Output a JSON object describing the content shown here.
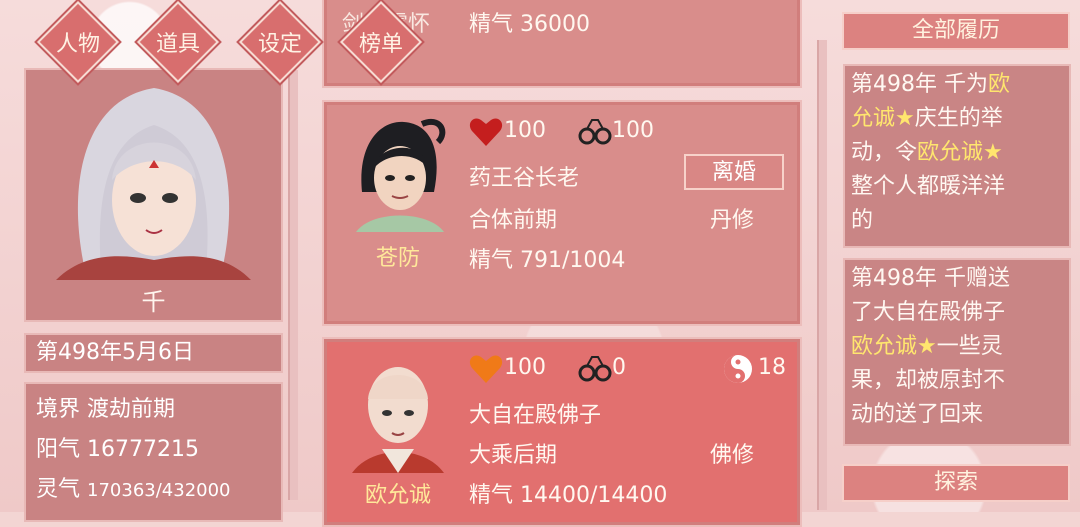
{
  "tabs": [
    "人物",
    "道具",
    "设定",
    "榜单"
  ],
  "player": {
    "name": "千",
    "date": "第498年5月6日",
    "realm_label": "境界",
    "realm_value": "渡劫前期",
    "yang_label": "阳气",
    "yang_value": "16777215",
    "ling_label": "灵气",
    "ling_value": "170363/432000"
  },
  "cards": [
    {
      "name_fragment": "剑灵零怀",
      "essence_label": "精气",
      "essence_value": "36000"
    },
    {
      "name": "苍防",
      "affection": "100",
      "bond": "100",
      "title": "药王谷长老",
      "realm": "合体前期",
      "path": "丹修",
      "essence_label": "精气",
      "essence_value": "791/1004",
      "button": "离婚"
    },
    {
      "name": "欧允诚",
      "affection": "100",
      "bond": "0",
      "yinyang": "18",
      "title": "大自在殿佛子",
      "realm": "大乘后期",
      "path": "佛修",
      "essence_label": "精气",
      "essence_value": "14400/14400"
    }
  ],
  "history": {
    "title": "全部履历",
    "entries": [
      {
        "l1": "第498年 千为",
        "l1b": "欧",
        "l2a": "允诚★",
        "l2b": "庆生的举",
        "l3a": "动，令",
        "l3b": "欧允诚★",
        "l4": "整个人都暖洋洋",
        "l5": "的"
      },
      {
        "l1": "第498年 千赠送",
        "l2": "了大自在殿佛子",
        "l3a": "欧允诚★",
        "l3b": "一些灵",
        "l4": "果，却被原封不",
        "l5": "动的送了回来"
      }
    ],
    "explore": "探索"
  },
  "colors": {
    "heart_red": "#c41e1e",
    "heart_orange": "#f07a18",
    "highlight": "#ffe66e",
    "card_bg": "#d98d8b"
  }
}
